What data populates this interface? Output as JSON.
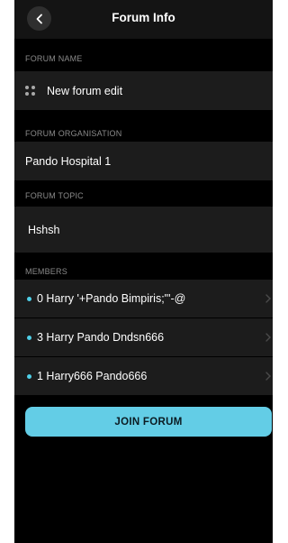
{
  "header": {
    "title": "Forum Info",
    "back_icon": "chevron-left-icon"
  },
  "forum_name": {
    "label": "FORUM NAME",
    "icon": "dots-grid-icon",
    "value": "New forum edit"
  },
  "forum_organisation": {
    "label": "FORUM ORGANISATION",
    "value": "Pando Hospital 1"
  },
  "forum_topic": {
    "label": "FORUM TOPIC",
    "value": "Hshsh"
  },
  "members": {
    "label": "MEMBERS",
    "items": [
      {
        "label": "0 Harry '+Pando Bimpiris;\"'-@"
      },
      {
        "label": "3 Harry Pando Dndsn666"
      },
      {
        "label": "1 Harry666 Pando666"
      }
    ],
    "status_dot_color": "#4fd0e8"
  },
  "join_button": {
    "label": "JOIN FORUM",
    "color": "#63cde6"
  }
}
